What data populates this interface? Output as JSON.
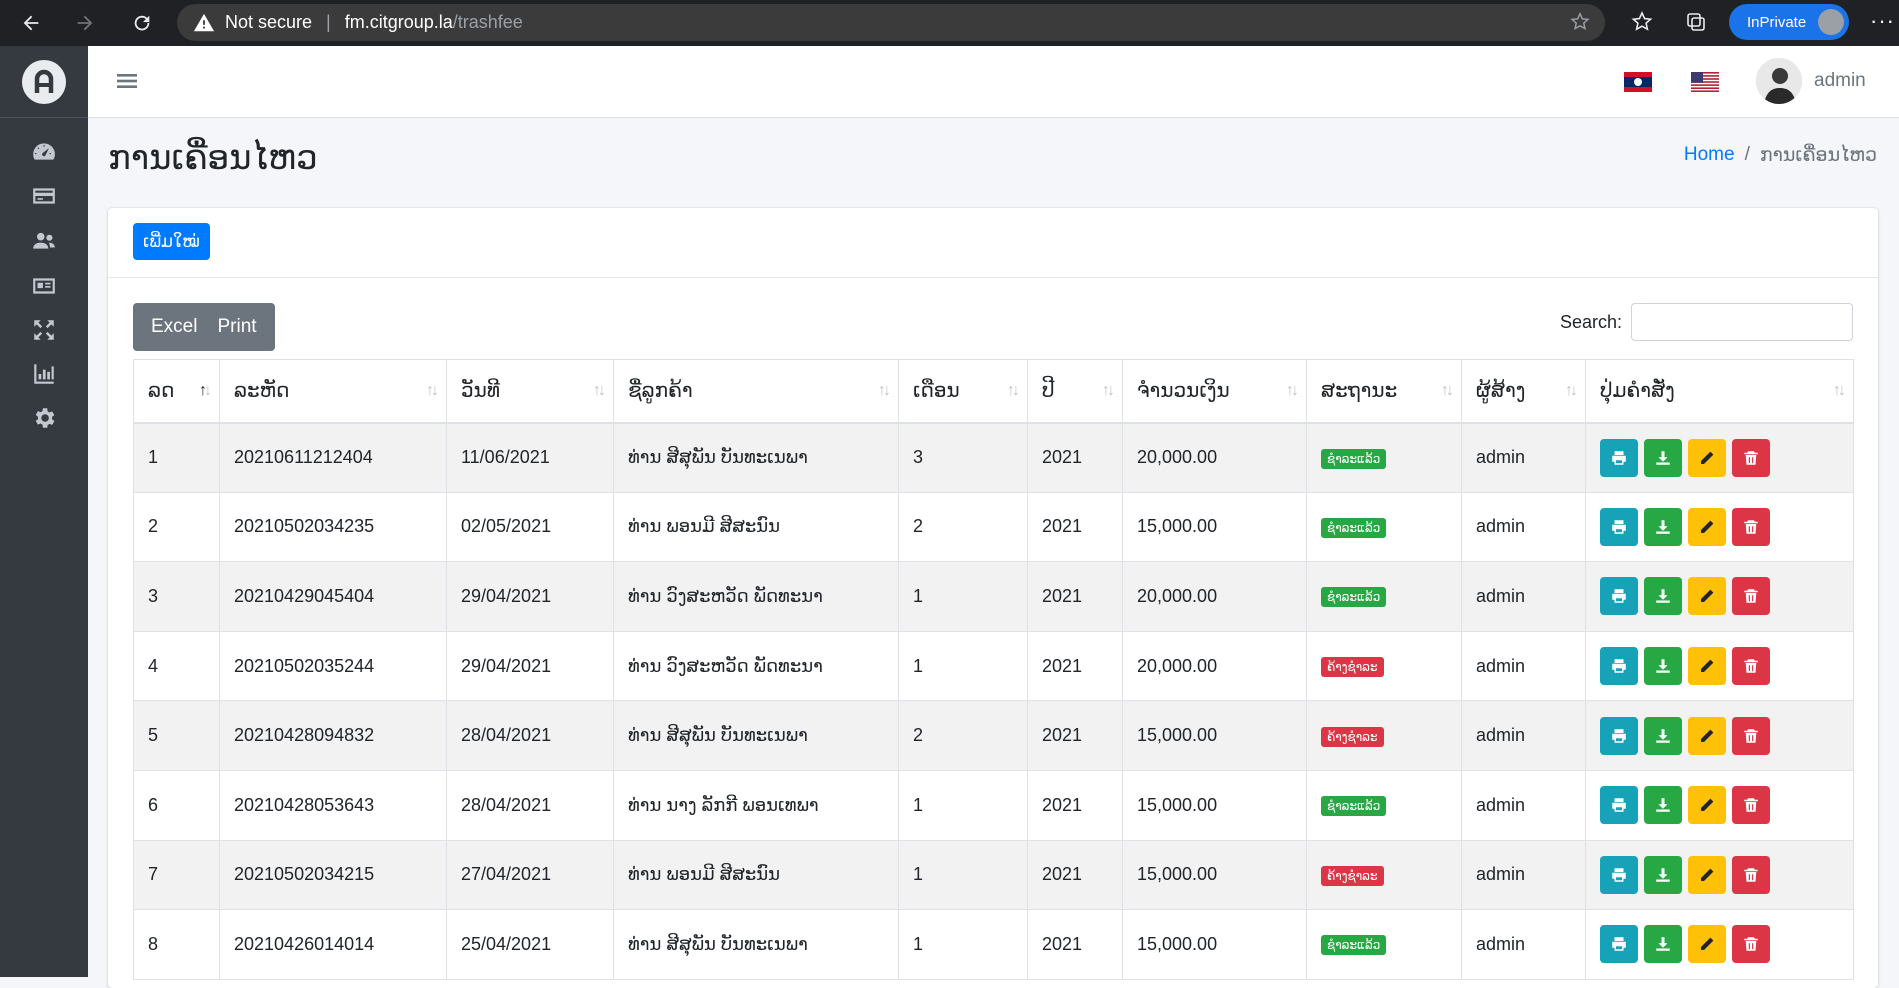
{
  "browser": {
    "not_secure": "Not secure",
    "host": "fm.citgroup.la",
    "path": "/trashfee",
    "inprivate": "InPrivate"
  },
  "navbar": {
    "user": "admin"
  },
  "page": {
    "title": "ການເຄື່ອນໄຫວ",
    "breadcrumb_home": "Home",
    "breadcrumb_sep": "/",
    "breadcrumb_current": "ການເຄື່ອນໄຫວ"
  },
  "toolbar": {
    "new_label": "ເພີ່ມໃໝ່",
    "excel_label": "Excel",
    "print_label": "Print",
    "search_label": "Search:",
    "search_value": ""
  },
  "table": {
    "columns": [
      "ລດ",
      "ລະຫັດ",
      "ວັນທີ",
      "ຊື່ລູກຄ້າ",
      "ເດືອນ",
      "ປີ",
      "ຈຳນວນເງິນ",
      "ສະຖານະ",
      "ຜູ້ສ້າງ",
      "ປຸ່ມຄຳສັ່ງ"
    ],
    "rows": [
      {
        "no": "1",
        "code": "20210611212404",
        "date": "11/06/2021",
        "customer": "ທ່ານ ສີສຸພັນ ບັນທະເນພາ",
        "month": "3",
        "year": "2021",
        "amount": "20,000.00",
        "status": "ຊຳລະແລ້ວ",
        "status_type": "paid",
        "creator": "admin"
      },
      {
        "no": "2",
        "code": "20210502034235",
        "date": "02/05/2021",
        "customer": "ທ່ານ ພອນມີ ສີສະນົນ",
        "month": "2",
        "year": "2021",
        "amount": "15,000.00",
        "status": "ຊຳລະແລ້ວ",
        "status_type": "paid",
        "creator": "admin"
      },
      {
        "no": "3",
        "code": "20210429045404",
        "date": "29/04/2021",
        "customer": "ທ່ານ ວົງສະຫວັດ ພັດທະນາ",
        "month": "1",
        "year": "2021",
        "amount": "20,000.00",
        "status": "ຊຳລະແລ້ວ",
        "status_type": "paid",
        "creator": "admin"
      },
      {
        "no": "4",
        "code": "20210502035244",
        "date": "29/04/2021",
        "customer": "ທ່ານ ວົງສະຫວັດ ພັດທະນາ",
        "month": "1",
        "year": "2021",
        "amount": "20,000.00",
        "status": "ຄ້າງຊຳລະ",
        "status_type": "unpaid",
        "creator": "admin"
      },
      {
        "no": "5",
        "code": "20210428094832",
        "date": "28/04/2021",
        "customer": "ທ່ານ ສີສຸພັນ ບັນທະເນພາ",
        "month": "2",
        "year": "2021",
        "amount": "15,000.00",
        "status": "ຄ້າງຊຳລະ",
        "status_type": "unpaid",
        "creator": "admin"
      },
      {
        "no": "6",
        "code": "20210428053643",
        "date": "28/04/2021",
        "customer": "ທ່ານ ນາງ ລັກກີ ພອນເທພາ",
        "month": "1",
        "year": "2021",
        "amount": "15,000.00",
        "status": "ຊຳລະແລ້ວ",
        "status_type": "paid",
        "creator": "admin"
      },
      {
        "no": "7",
        "code": "20210502034215",
        "date": "27/04/2021",
        "customer": "ທ່ານ ພອນມີ ສີສະນົນ",
        "month": "1",
        "year": "2021",
        "amount": "15,000.00",
        "status": "ຄ້າງຊຳລະ",
        "status_type": "unpaid",
        "creator": "admin"
      },
      {
        "no": "8",
        "code": "20210426014014",
        "date": "25/04/2021",
        "customer": "ທ່ານ ສີສຸພັນ ບັນທະເນພາ",
        "month": "1",
        "year": "2021",
        "amount": "15,000.00",
        "status": "ຊຳລະແລ້ວ",
        "status_type": "paid",
        "creator": "admin"
      }
    ]
  },
  "colors": {
    "sidebar_bg": "#343a40",
    "primary": "#007bff",
    "paid": "#28a745",
    "unpaid": "#dc3545",
    "print_btn": "#17a2b8",
    "edit_btn": "#ffc107"
  }
}
